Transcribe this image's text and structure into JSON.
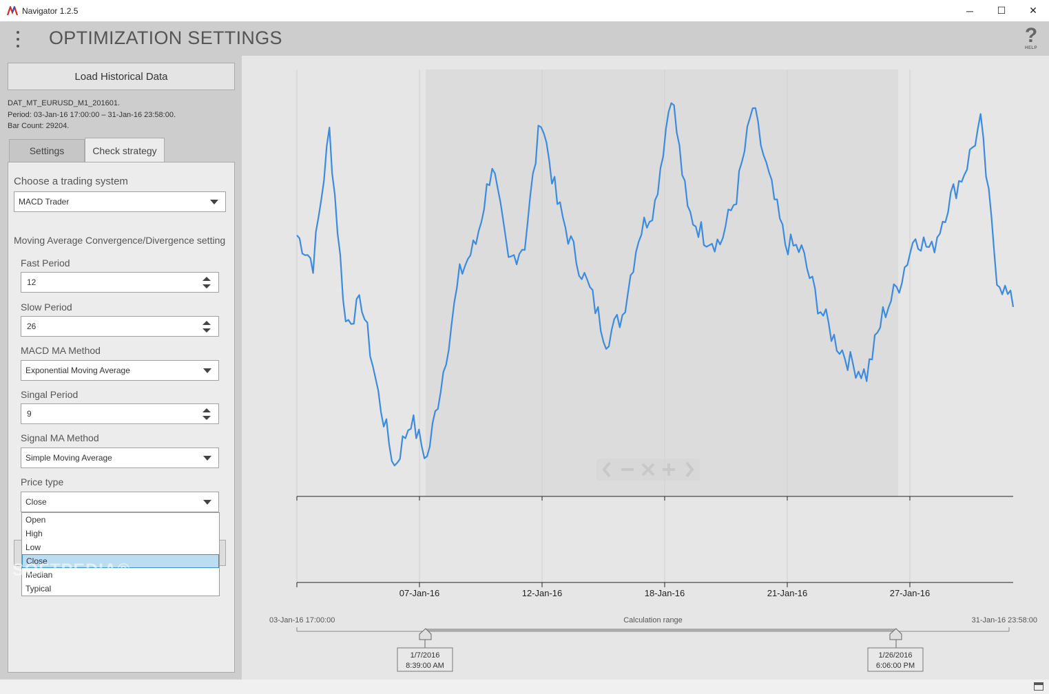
{
  "window": {
    "title": "Navigator 1.2.5",
    "minimize_glyph": "─",
    "maximize_glyph": "☐",
    "close_glyph": "✕"
  },
  "header": {
    "title": "OPTIMIZATION SETTINGS",
    "help_glyph": "?",
    "help_label": "HELP"
  },
  "left": {
    "load_button": "Load Historical Data",
    "file_name": "DAT_MT_EURUSD_M1_201601.",
    "period": "Period: 03-Jan-16 17:00:00 – 31-Jan-16 23:58:00.",
    "bar_count": "Bar Count: 29204.",
    "tabs": [
      "Settings",
      "Check strategy"
    ],
    "trading_system_label": "Choose a trading system",
    "trading_system_value": "MACD Trader",
    "macd_section_label": "Moving Average Convergence/Divergence setting",
    "fast_period_label": "Fast Period",
    "fast_period_value": "12",
    "slow_period_label": "Slow Period",
    "slow_period_value": "26",
    "macd_ma_method_label": "MACD MA Method",
    "macd_ma_method_value": "Exponential Moving Average",
    "signal_period_label": "Singal Period",
    "signal_period_value": "9",
    "signal_ma_method_label": "Signal MA Method",
    "signal_ma_method_value": "Simple Moving Average",
    "price_type_label": "Price type",
    "price_type_value": "Close",
    "price_type_options": [
      "Open",
      "High",
      "Low",
      "Close",
      "Median",
      "Typical"
    ],
    "watermark": "SOFTPEDIA®"
  },
  "chart": {
    "x_ticks": [
      "07-Jan-16",
      "12-Jan-16",
      "18-Jan-16",
      "21-Jan-16",
      "27-Jan-16"
    ],
    "range_start": "03-Jan-16 17:00:00",
    "range_end": "31-Jan-16 23:58:00",
    "range_label": "Calculation range",
    "left_handle_date": "1/7/2016",
    "left_handle_time": "8:39:00 AM",
    "right_handle_date": "1/26/2016",
    "right_handle_time": "6:06:00 PM",
    "zoom_glyphs": [
      "‹",
      "−",
      "✕",
      "+",
      "›"
    ],
    "accent": "#3b8be0"
  },
  "chart_data": {
    "type": "line",
    "series": [
      {
        "values": [
          0.62,
          0.55,
          0.88,
          0.4,
          0.45,
          0.22,
          0.04,
          0.16,
          0.06,
          0.28,
          0.52,
          0.6,
          0.8,
          0.55,
          0.6,
          0.92,
          0.7,
          0.58,
          0.48,
          0.36,
          0.42,
          0.62,
          0.7,
          0.98,
          0.68,
          0.62,
          0.6,
          0.72,
          0.94,
          0.76,
          0.6,
          0.58,
          0.45,
          0.36,
          0.3,
          0.27,
          0.42,
          0.5,
          0.62,
          0.58,
          0.7,
          0.78,
          0.9,
          0.52,
          0.44
        ]
      }
    ]
  }
}
